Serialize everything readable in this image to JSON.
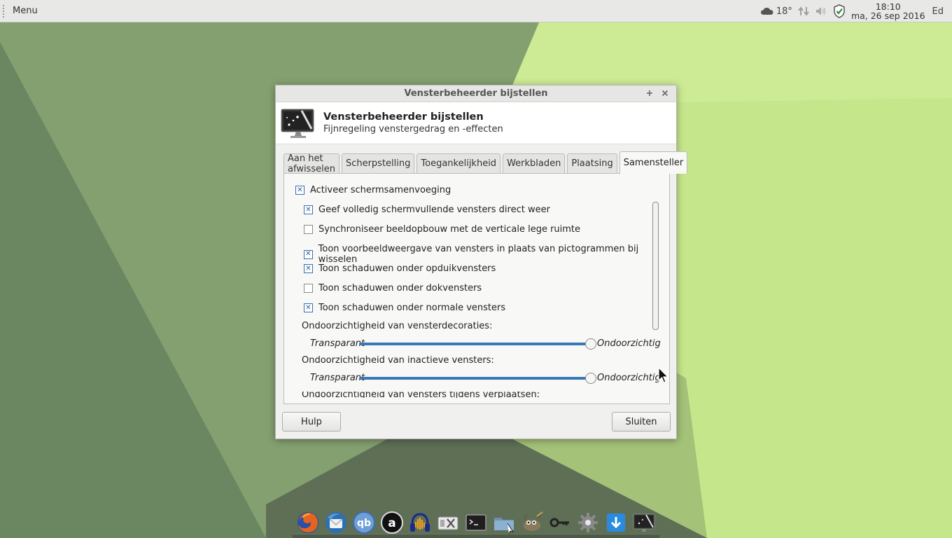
{
  "panel": {
    "menu_label": "Menu",
    "weather_temp": "18°",
    "clock_time": "18:10",
    "clock_date": "ma, 26 sep 2016",
    "user": "Ed"
  },
  "dialog": {
    "window_title": "Vensterbeheerder bijstellen",
    "header_title": "Vensterbeheerder bijstellen",
    "header_subtitle": "Fijnregeling venstergedrag en -effecten",
    "tabs": [
      {
        "label": "Aan het afwisselen",
        "active": false
      },
      {
        "label": "Scherpstelling",
        "active": false
      },
      {
        "label": "Toegankelijkheid",
        "active": false
      },
      {
        "label": "Werkbladen",
        "active": false
      },
      {
        "label": "Plaatsing",
        "active": false
      },
      {
        "label": "Samensteller",
        "active": true
      }
    ],
    "compositor": {
      "enable": {
        "label": "Activeer schermsamenvoeging",
        "checked": true
      },
      "options": [
        {
          "label": "Geef volledig schermvullende vensters direct weer",
          "checked": true
        },
        {
          "label": "Synchroniseer beeldopbouw met de verticale lege ruimte",
          "checked": false
        },
        {
          "label": "Toon voorbeeldweergave van vensters in plaats van pictogrammen bij wisselen",
          "checked": true
        },
        {
          "label": "Toon schaduwen onder opduikvensters",
          "checked": true
        },
        {
          "label": "Toon schaduwen onder dokvensters",
          "checked": false
        },
        {
          "label": "Toon schaduwen onder normale vensters",
          "checked": true
        }
      ],
      "sliders": [
        {
          "label": "Ondoorzichtigheid van vensterdecoraties:",
          "min_label": "Transparant",
          "max_label": "Ondoorzichtig",
          "value": 1.0
        },
        {
          "label": "Ondoorzichtigheid van inactieve vensters:",
          "min_label": "Transparant",
          "max_label": "Ondoorzichtig",
          "value": 1.0
        }
      ],
      "partial_label": "Ondoorzichtigheid van vensters tijdens verplaatsen:"
    },
    "help_label": "Hulp",
    "close_label": "Sluiten"
  },
  "dock": {
    "icons": [
      "firefox-icon",
      "thunderbird-icon",
      "qbittorrent-icon",
      "amarok-icon",
      "audacity-icon",
      "settings-manager-icon",
      "terminal-icon",
      "file-manager-icon",
      "gimp-icon",
      "keys-icon",
      "gear-icon",
      "download-icon",
      "window-manager-tweaks-icon"
    ]
  },
  "colors": {
    "accent": "#3a78b8",
    "panel_bg": "#e8e8e6",
    "wallpaper_dark": "#6c8a60",
    "wallpaper_light": "#c8e88a"
  }
}
